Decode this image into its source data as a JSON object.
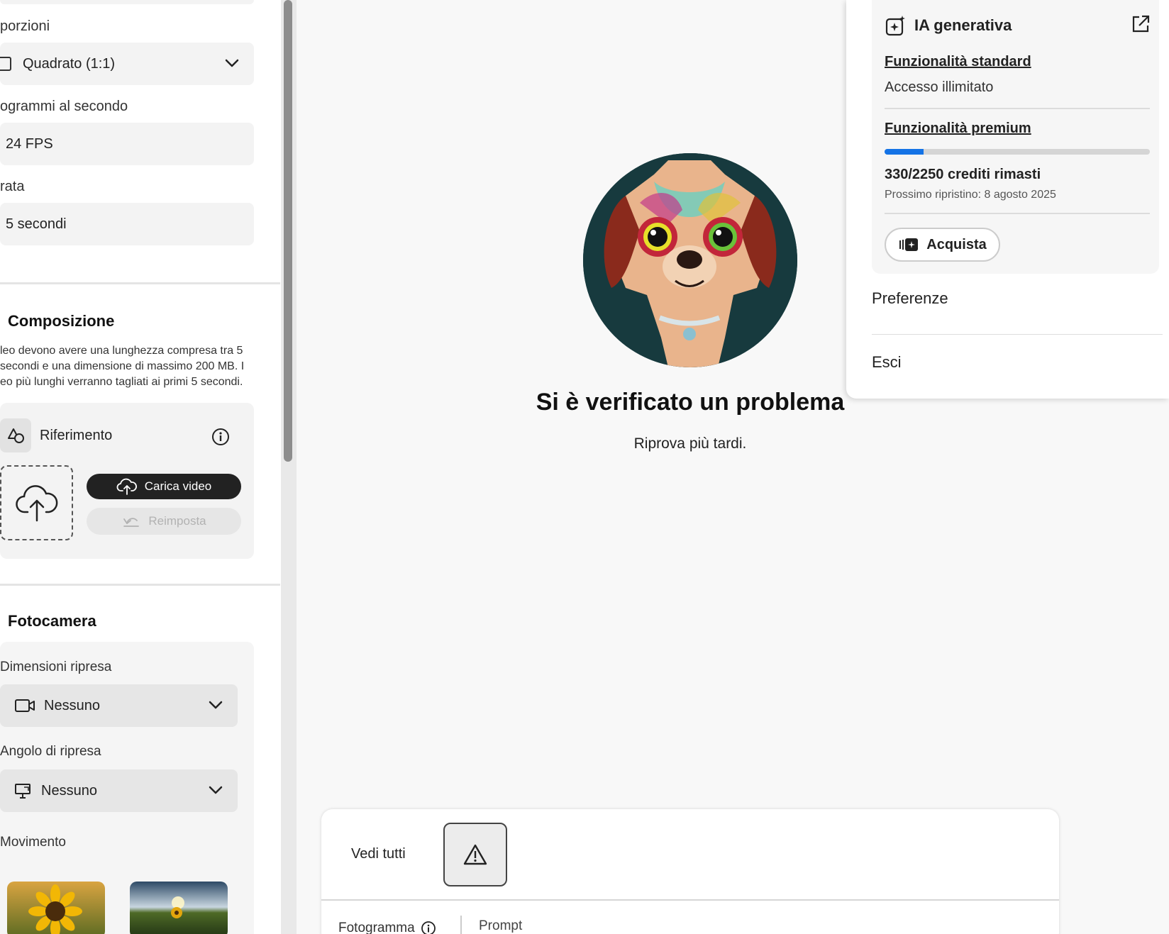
{
  "left_panel": {
    "aspect": {
      "label": "porzioni",
      "value": "Quadrato (1:1)"
    },
    "fps": {
      "label": "ogrammi al secondo",
      "value": "24 FPS"
    },
    "duration": {
      "label": "rata",
      "value": "5 secondi"
    },
    "composition": {
      "title": "Composizione",
      "description": "leo devono avere una lunghezza compresa tra 5 secondi e una dimensione di massimo 200 MB. I eo più lunghi verranno tagliati ai primi 5 secondi.",
      "reference_label": "Riferimento",
      "upload_button": "Carica video",
      "reset_button": "Reimposta"
    },
    "camera": {
      "title": "Fotocamera",
      "shot_size_label": "Dimensioni ripresa",
      "shot_size_value": "Nessuno",
      "angle_label": "Angolo di ripresa",
      "angle_value": "Nessuno",
      "movement_label": "Movimento"
    }
  },
  "main": {
    "error_title": "Si è verificato un problema",
    "error_subtitle": "Riprova più tardi."
  },
  "bottom": {
    "see_all": "Vedi tutti",
    "frame_label": "Fotogramma",
    "prompt_label": "Prompt"
  },
  "flyout": {
    "title": "IA generativa",
    "standard_heading": "Funzionalità standard",
    "standard_access": "Accesso illimitato",
    "premium_heading": "Funzionalità premium",
    "credits_used_fraction": 0.147,
    "credits_text": "330/2250 crediti rimasti",
    "next_reset": "Prossimo ripristino: 8 agosto 2025",
    "buy_button": "Acquista",
    "menu": [
      "Preferenze",
      "Esci"
    ]
  },
  "colors": {
    "accent": "#1473e6",
    "dark_button": "#222222"
  }
}
